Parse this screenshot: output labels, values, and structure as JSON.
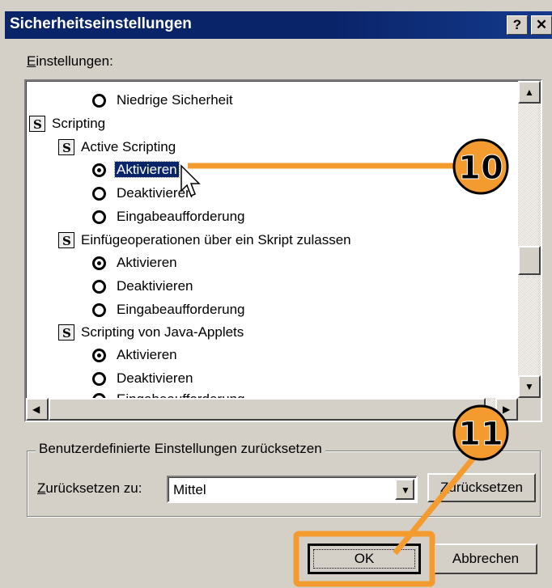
{
  "window": {
    "title": "Sicherheitseinstellungen",
    "help_glyph": "?",
    "close_glyph": "✕"
  },
  "settings": {
    "label_accel": "E",
    "label_rest": "instellungen:",
    "items": [
      {
        "kind": "radio",
        "label": "Niedrige Sicherheit",
        "checked": false
      },
      {
        "kind": "category",
        "label": "Scripting",
        "icon": "script-icon"
      },
      {
        "kind": "setting",
        "label": "Active Scripting",
        "icon": "script-icon"
      },
      {
        "kind": "radio",
        "label": "Aktivieren",
        "checked": true,
        "selected": true
      },
      {
        "kind": "radio",
        "label": "Deaktivieren",
        "checked": false
      },
      {
        "kind": "radio",
        "label": "Eingabeaufforderung",
        "checked": false
      },
      {
        "kind": "setting",
        "label": "Einfügeoperationen über ein Skript zulassen",
        "icon": "script-icon"
      },
      {
        "kind": "radio",
        "label": "Aktivieren",
        "checked": true
      },
      {
        "kind": "radio",
        "label": "Deaktivieren",
        "checked": false
      },
      {
        "kind": "radio",
        "label": "Eingabeaufforderung",
        "checked": false
      },
      {
        "kind": "setting",
        "label": "Scripting von Java-Applets",
        "icon": "script-icon"
      },
      {
        "kind": "radio",
        "label": "Aktivieren",
        "checked": true
      },
      {
        "kind": "radio",
        "label": "Deaktivieren",
        "checked": false
      },
      {
        "kind": "radio",
        "label": "Eingabeaufforderung",
        "checked": false
      }
    ]
  },
  "reset_group": {
    "legend": "Benutzerdefinierte Einstellungen zurücksetzen",
    "label_accel": "Z",
    "label_rest": "urücksetzen zu:",
    "selected_value": "Mittel",
    "reset_button_accel": "Z",
    "reset_button_rest": "urücksetzen"
  },
  "buttons": {
    "ok": "OK",
    "cancel": "Abbrechen"
  },
  "callouts": [
    {
      "number": "10",
      "color": "#f39b2e"
    },
    {
      "number": "11",
      "color": "#f39b2e"
    }
  ]
}
